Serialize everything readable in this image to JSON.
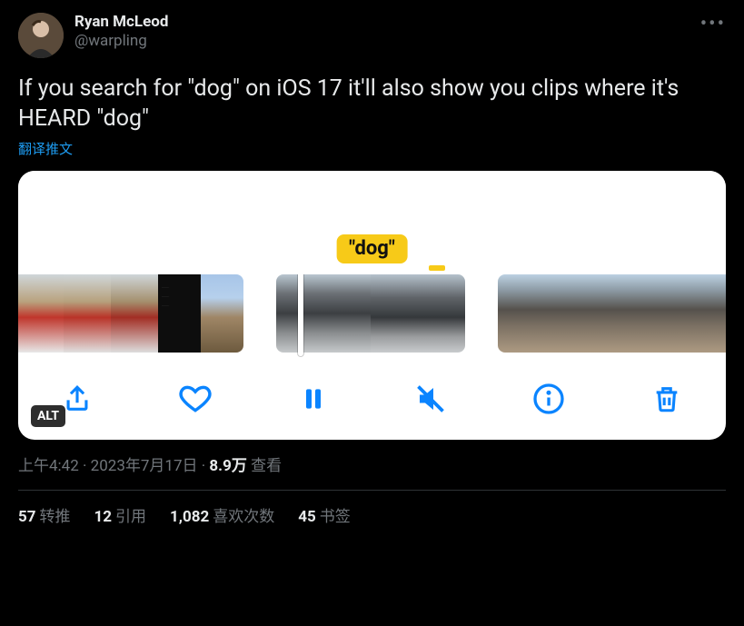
{
  "author": {
    "display_name": "Ryan McLeod",
    "handle": "@warpling"
  },
  "tweet_text": "If you search for \"dog\" on iOS 17 it'll also show you clips where it's HEARD \"dog\"",
  "translate_label": "翻译推文",
  "media": {
    "caption_badge": "\"dog\"",
    "alt_badge": "ALT"
  },
  "meta": {
    "time": "上午4:42",
    "date": "2023年7月17日",
    "views_number": "8.9万",
    "views_label": "查看",
    "separator": " · "
  },
  "stats": {
    "retweets": {
      "count": "57",
      "label": "转推"
    },
    "quotes": {
      "count": "12",
      "label": "引用"
    },
    "likes": {
      "count": "1,082",
      "label": "喜欢次数"
    },
    "bookmarks": {
      "count": "45",
      "label": "书签"
    }
  },
  "icons": {
    "share": "share-icon",
    "like": "heart-icon",
    "pause": "pause-icon",
    "mute": "mute-icon",
    "info": "info-icon",
    "trash": "trash-icon",
    "more": "more-icon"
  }
}
